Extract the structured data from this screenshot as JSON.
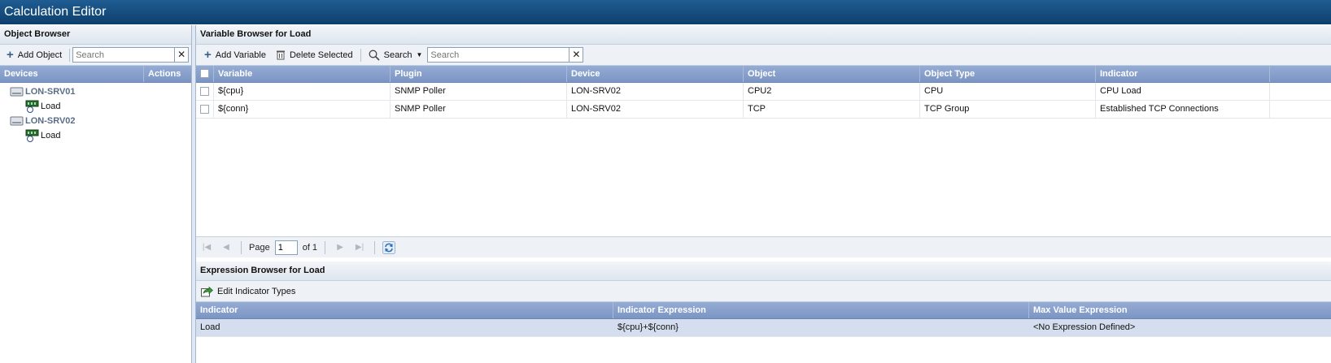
{
  "app": {
    "title": "Calculation Editor"
  },
  "object_browser": {
    "title": "Object Browser",
    "add_object_label": "Add Object",
    "search_placeholder": "Search",
    "clear_glyph": "✕",
    "col_devices": "Devices",
    "col_actions": "Actions",
    "tree": [
      {
        "device": "LON-SRV01",
        "child": "Load",
        "icon": "server-icon",
        "child_icon": "plugin-load-icon"
      },
      {
        "device": "LON-SRV02",
        "child": "Load",
        "icon": "server-icon",
        "child_icon": "plugin-load-icon"
      }
    ]
  },
  "variable_browser": {
    "title": "Variable Browser for Load",
    "add_variable_label": "Add Variable",
    "delete_selected_label": "Delete Selected",
    "search_menu_label": "Search",
    "search_placeholder": "Search",
    "clear_glyph": "✕",
    "columns": [
      "Variable",
      "Plugin",
      "Device",
      "Object",
      "Object Type",
      "Indicator"
    ],
    "rows": [
      [
        "${cpu}",
        "SNMP Poller",
        "LON-SRV02",
        "CPU2",
        "CPU",
        "CPU Load"
      ],
      [
        "${conn}",
        "SNMP Poller",
        "LON-SRV02",
        "TCP",
        "TCP Group",
        "Established TCP Connections"
      ]
    ],
    "pager": {
      "page_label": "Page",
      "page_value": "1",
      "of_label": "of 1"
    }
  },
  "expression_browser": {
    "title": "Expression Browser for Load",
    "edit_types_label": "Edit Indicator Types",
    "columns": [
      "Indicator",
      "Indicator Expression",
      "Max Value Expression"
    ],
    "rows": [
      [
        "Load",
        "${cpu}+${conn}",
        "<No Expression Defined>"
      ]
    ]
  },
  "colors": {
    "titlebar": "#0d3f6c",
    "grid_header": "#7b95c3",
    "selected_row": "#d4deef"
  }
}
